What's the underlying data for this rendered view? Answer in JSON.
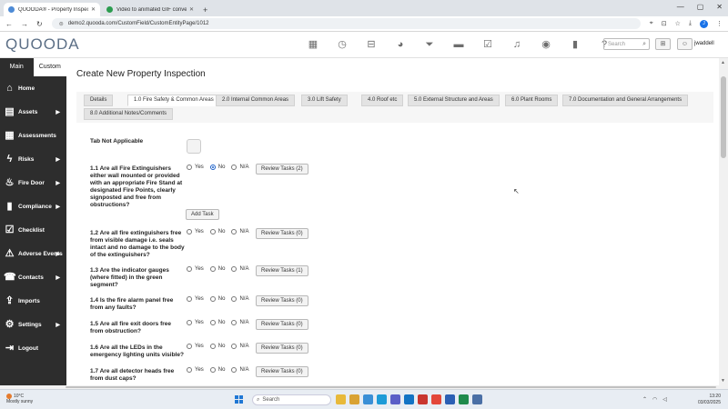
{
  "browser": {
    "tabs": [
      {
        "title": "QUOODA® - Property Inspectio",
        "active": true,
        "fav_color": "#4d8bd6"
      },
      {
        "title": "Video to animated GIF converte",
        "active": false,
        "fav_color": "#2b9c4f"
      }
    ],
    "new_tab": "+",
    "url": "demo2.quooda.com/CustomField/CustomEntityPage/1012",
    "window_controls": [
      "—",
      "▢",
      "✕"
    ]
  },
  "app": {
    "logo": "QUOODA",
    "search_placeholder": "Search",
    "username": "jwaddell",
    "header_icons": [
      "calendar-icon",
      "clock-icon",
      "inbox-icon",
      "pie-chart-icon",
      "filter-icon",
      "folder-icon",
      "checklist-icon",
      "bell-icon",
      "eye-icon",
      "bookmark-icon",
      "help-icon"
    ]
  },
  "sidebar": {
    "tabs": [
      {
        "label": "Main",
        "active": false
      },
      {
        "label": "Custom",
        "active": true
      }
    ],
    "items": [
      {
        "label": "Home",
        "icon": "home-icon",
        "glyph": "⌂",
        "arrow": false
      },
      {
        "label": "Assets",
        "icon": "assets-icon",
        "glyph": "▤",
        "arrow": true
      },
      {
        "label": "Assessments",
        "icon": "clipboard-icon",
        "glyph": "▦",
        "arrow": false
      },
      {
        "label": "Risks",
        "icon": "lightning-icon",
        "glyph": "ϟ",
        "arrow": true
      },
      {
        "label": "Fire Door",
        "icon": "flame-icon",
        "glyph": "♨",
        "arrow": true
      },
      {
        "label": "Compliance",
        "icon": "bar-chart-icon",
        "glyph": "▮",
        "arrow": true
      },
      {
        "label": "Checklist",
        "icon": "checklist-icon",
        "glyph": "☑",
        "arrow": false
      },
      {
        "label": "Adverse Events",
        "icon": "warning-icon",
        "glyph": "⚠",
        "arrow": true
      },
      {
        "label": "Contacts",
        "icon": "contacts-icon",
        "glyph": "☎",
        "arrow": true
      },
      {
        "label": "Imports",
        "icon": "imports-icon",
        "glyph": "⇪",
        "arrow": false
      },
      {
        "label": "Settings",
        "icon": "gear-icon",
        "glyph": "⚙",
        "arrow": true
      },
      {
        "label": "Logout",
        "icon": "logout-icon",
        "glyph": "⇥",
        "arrow": false
      }
    ]
  },
  "page": {
    "title": "Create New Property Inspection",
    "tabs": [
      {
        "label": "Details",
        "active": false
      },
      {
        "label": "1.0 Fire Safety & Common Areas",
        "active": true
      },
      {
        "label": "2.0 Internal Common Areas",
        "active": false
      },
      {
        "label": "3.0 Lift Safety",
        "active": false
      },
      {
        "label": "4.0 Roof etc",
        "active": false
      },
      {
        "label": "5.0 External Structure and Areas",
        "active": false
      },
      {
        "label": "6.0 Plant Rooms",
        "active": false
      },
      {
        "label": "7.0 Documentation and General Arrangements",
        "active": false
      },
      {
        "label": "8.0 Additional Notes/Comments",
        "active": false
      }
    ],
    "tab_not_applicable": "Tab Not Applicable",
    "add_task": "Add Task",
    "options": [
      "Yes",
      "No",
      "N/A"
    ],
    "questions": [
      {
        "text": "1.1 Are all Fire Extinguishers either wall mounted or provided with an appropriate Fire Stand at designated Fire Points, clearly signposted and free from obstructions?",
        "selected": "No",
        "review": "Review Tasks (2)"
      },
      {
        "text": "1.2 Are all fire extinguishers free from visible damage i.e. seals intact and no damage to the body of the extinguishers?",
        "selected": "",
        "review": "Review Tasks (0)"
      },
      {
        "text": "1.3 Are the indicator gauges (where fitted) in the green segment?",
        "selected": "",
        "review": "Review Tasks (1)"
      },
      {
        "text": "1.4 Is the fire alarm panel free from any faults?",
        "selected": "",
        "review": "Review Tasks (0)"
      },
      {
        "text": "1.5 Are all fire exit doors free from obstruction?",
        "selected": "",
        "review": "Review Tasks (0)"
      },
      {
        "text": "1.6 Are all the LEDs in the emergency lighting units visible?",
        "selected": "",
        "review": "Review Tasks (0)"
      },
      {
        "text": "1.7 Are all detector heads free from dust caps?",
        "selected": "",
        "review": "Review Tasks (0)"
      }
    ]
  },
  "taskbar": {
    "temperature": "10°C",
    "weather": "Mostly sunny",
    "search_label": "Search",
    "time": "13:20",
    "date": "03/03/2025",
    "apps": [
      {
        "name": "file-explorer-icon",
        "color": "#e8b93a"
      },
      {
        "name": "folder-app-icon",
        "color": "#d9a233"
      },
      {
        "name": "media-app-icon",
        "color": "#3a8fd6"
      },
      {
        "name": "edge-icon",
        "color": "#1d9bd7"
      },
      {
        "name": "teams-icon",
        "color": "#5b5fc7"
      },
      {
        "name": "outlook-icon",
        "color": "#1273c4"
      },
      {
        "name": "screen-recorder-icon",
        "color": "#c9362f"
      },
      {
        "name": "chrome-icon",
        "color": "#e3473a"
      },
      {
        "name": "word-icon",
        "color": "#2b5fb4"
      },
      {
        "name": "excel-icon",
        "color": "#1f8a4c"
      },
      {
        "name": "calculator-icon",
        "color": "#4a6fa5"
      }
    ]
  }
}
